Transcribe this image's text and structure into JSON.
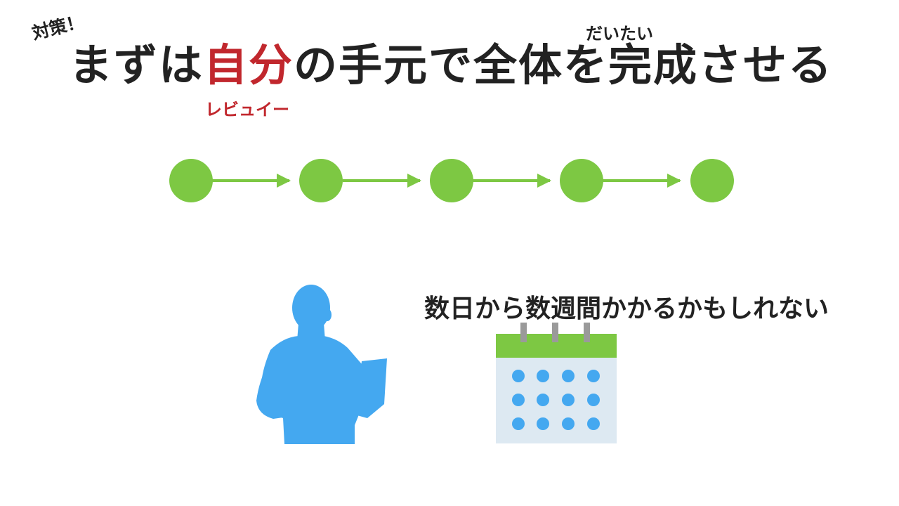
{
  "tag_label": "対策！",
  "title": {
    "pre": "まずは",
    "accent": "自分",
    "post": "の手元で全体を完成させる"
  },
  "ruby_top": "だいたい",
  "ruby_bottom": "レビュイー",
  "caption": "数日から数週間かかるかもしれない",
  "colors": {
    "accent": "#c1272d",
    "node": "#7dc843",
    "person": "#44a8f0",
    "calendar_header": "#7dc843",
    "calendar_body": "#dde9f2",
    "calendar_dots": "#44a8f0",
    "calendar_rings": "#9a9a9a"
  },
  "icons": [
    "flow-node",
    "arrow-right-icon",
    "person-with-laptop-icon",
    "calendar-icon"
  ]
}
